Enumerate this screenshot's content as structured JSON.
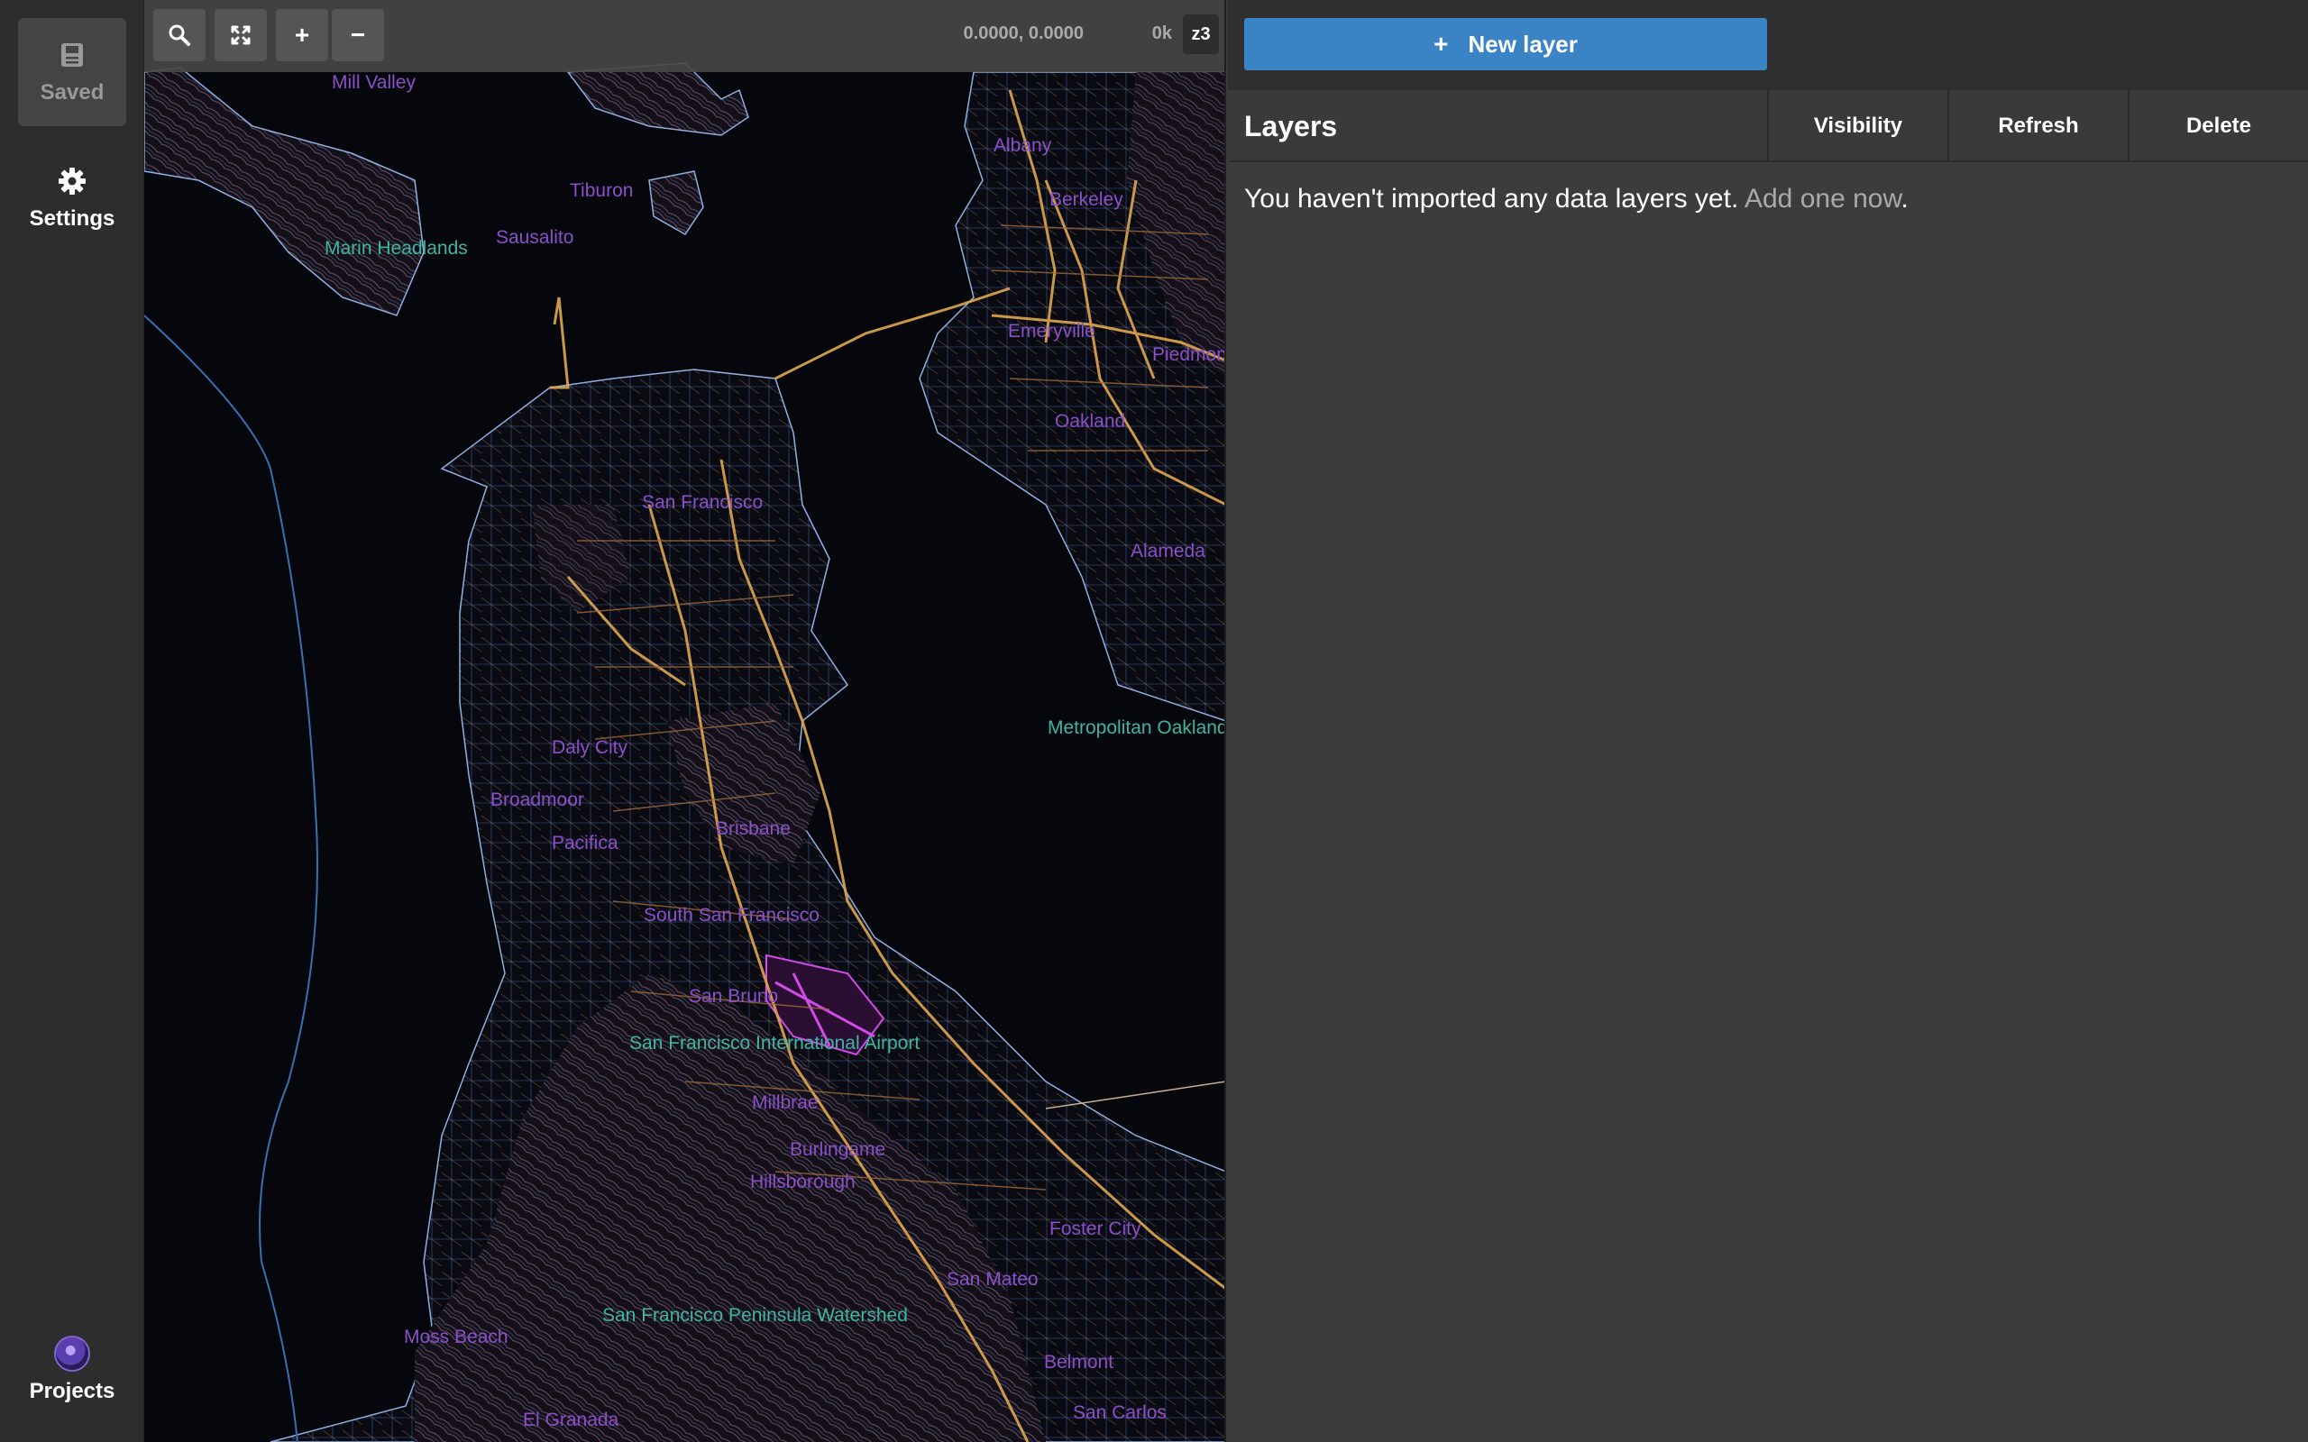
{
  "nav": {
    "saved_label": "Saved",
    "settings_label": "Settings",
    "projects_label": "Projects"
  },
  "map_toolbar": {
    "coordinates": "0.0000, 0.0000",
    "tile_size": "0k",
    "zoom_label": "z3",
    "zoom_in": "+",
    "zoom_out": "−"
  },
  "map_labels": {
    "places": [
      "Mill Valley",
      "Tiburon",
      "Sausalito",
      "Albany",
      "Berkeley",
      "Emeryville",
      "Piedmont",
      "Oakland",
      "Alameda",
      "San Francisco",
      "Daly City",
      "Broadmoor",
      "Pacifica",
      "Brisbane",
      "South San Francisco",
      "San Bruno",
      "Millbrae",
      "Burlingame",
      "Hillsborough",
      "Foster City",
      "San Mateo",
      "Belmont",
      "San Carlos",
      "Moss Beach",
      "El Granada"
    ],
    "parks": [
      "Marin Headlands",
      "Metropolitan Oakland",
      "San Francisco International Airport",
      "San Francisco Peninsula Watershed"
    ]
  },
  "panel": {
    "new_layer_label": "New layer",
    "layers_title": "Layers",
    "columns": [
      "Visibility",
      "Refresh",
      "Delete"
    ],
    "empty_message": "You haven't imported any data layers yet.",
    "empty_link": "Add one now",
    "empty_suffix": "."
  },
  "colors": {
    "accent": "#3a84c5",
    "map_background": "#06070c",
    "road": "#e0a850",
    "place_label": "#8b4fc9",
    "park_label": "#3fb5a0"
  }
}
